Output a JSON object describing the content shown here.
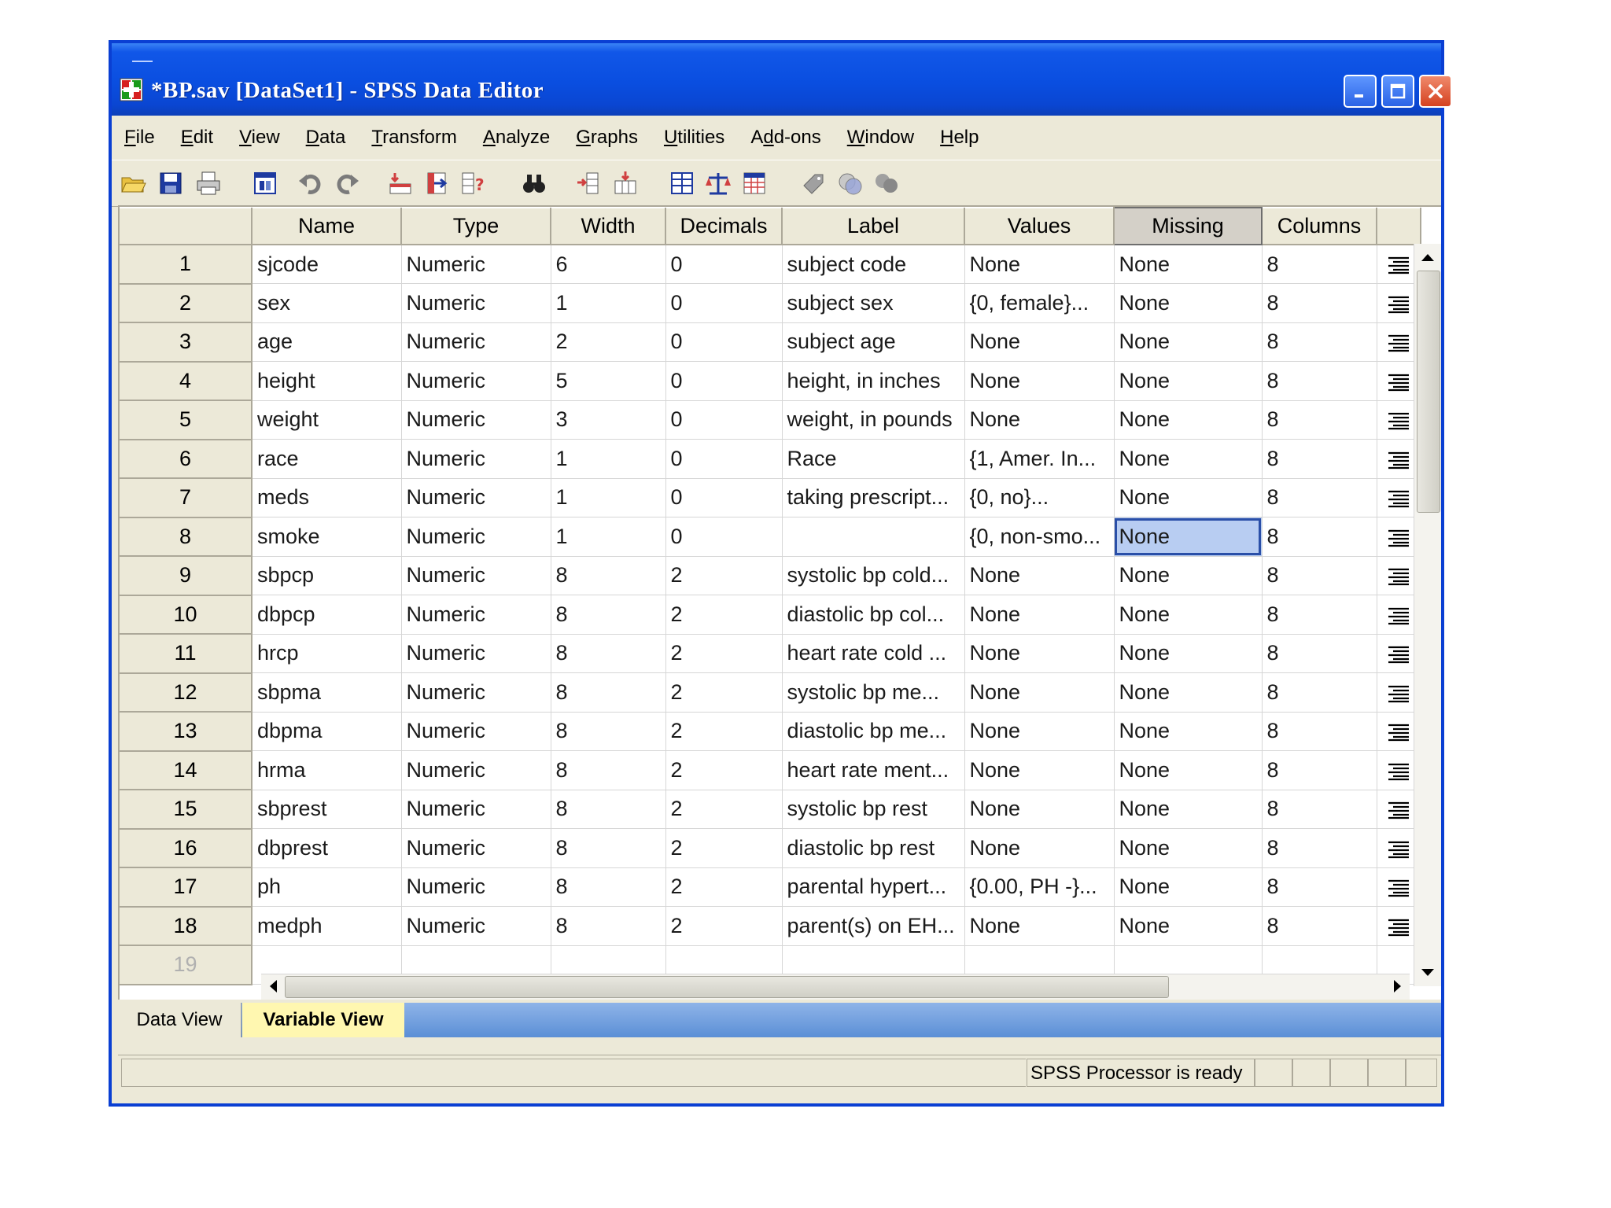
{
  "window": {
    "title": "*BP.sav [DataSet1] - SPSS Data Editor"
  },
  "menu": [
    {
      "pre": "",
      "ul": "F",
      "post": "ile"
    },
    {
      "pre": "",
      "ul": "E",
      "post": "dit"
    },
    {
      "pre": "",
      "ul": "V",
      "post": "iew"
    },
    {
      "pre": "",
      "ul": "D",
      "post": "ata"
    },
    {
      "pre": "",
      "ul": "T",
      "post": "ransform"
    },
    {
      "pre": "",
      "ul": "A",
      "post": "nalyze"
    },
    {
      "pre": "",
      "ul": "G",
      "post": "raphs"
    },
    {
      "pre": "",
      "ul": "U",
      "post": "tilities"
    },
    {
      "pre": "A",
      "ul": "d",
      "post": "d-ons"
    },
    {
      "pre": "",
      "ul": "W",
      "post": "indow"
    },
    {
      "pre": "",
      "ul": "H",
      "post": "elp"
    }
  ],
  "toolbar_icons": [
    "open-folder-icon",
    "save-icon",
    "print-icon",
    "dialog-recall-icon",
    "undo-icon",
    "redo-icon",
    "goto-case-icon",
    "goto-variable-icon",
    "variables-icon",
    "find-icon",
    "insert-cases-icon",
    "insert-variable-icon",
    "split-file-icon",
    "weight-cases-icon",
    "select-cases-icon",
    "value-labels-icon",
    "use-sets-icon",
    "show-all-variables-icon"
  ],
  "grid": {
    "columns": [
      "Name",
      "Type",
      "Width",
      "Decimals",
      "Label",
      "Values",
      "Missing",
      "Columns"
    ],
    "rows": [
      {
        "n": "1",
        "name": "sjcode",
        "type": "Numeric",
        "width": "6",
        "decimals": "0",
        "label": "subject code",
        "values": "None",
        "missing": "None",
        "columns": "8"
      },
      {
        "n": "2",
        "name": "sex",
        "type": "Numeric",
        "width": "1",
        "decimals": "0",
        "label": "subject sex",
        "values": "{0, female}...",
        "missing": "None",
        "columns": "8"
      },
      {
        "n": "3",
        "name": "age",
        "type": "Numeric",
        "width": "2",
        "decimals": "0",
        "label": "subject age",
        "values": "None",
        "missing": "None",
        "columns": "8"
      },
      {
        "n": "4",
        "name": "height",
        "type": "Numeric",
        "width": "5",
        "decimals": "0",
        "label": "height, in inches",
        "values": "None",
        "missing": "None",
        "columns": "8"
      },
      {
        "n": "5",
        "name": "weight",
        "type": "Numeric",
        "width": "3",
        "decimals": "0",
        "label": "weight, in pounds",
        "values": "None",
        "missing": "None",
        "columns": "8"
      },
      {
        "n": "6",
        "name": "race",
        "type": "Numeric",
        "width": "1",
        "decimals": "0",
        "label": "Race",
        "values": "{1, Amer. In...",
        "missing": "None",
        "columns": "8"
      },
      {
        "n": "7",
        "name": "meds",
        "type": "Numeric",
        "width": "1",
        "decimals": "0",
        "label": "taking prescript...",
        "values": "{0, no}...",
        "missing": "None",
        "columns": "8"
      },
      {
        "n": "8",
        "name": "smoke",
        "type": "Numeric",
        "width": "1",
        "decimals": "0",
        "label": "",
        "values": "{0, non-smo...",
        "missing": "None",
        "columns": "8"
      },
      {
        "n": "9",
        "name": "sbpcp",
        "type": "Numeric",
        "width": "8",
        "decimals": "2",
        "label": "systolic bp cold...",
        "values": "None",
        "missing": "None",
        "columns": "8"
      },
      {
        "n": "10",
        "name": "dbpcp",
        "type": "Numeric",
        "width": "8",
        "decimals": "2",
        "label": "diastolic bp col...",
        "values": "None",
        "missing": "None",
        "columns": "8"
      },
      {
        "n": "11",
        "name": "hrcp",
        "type": "Numeric",
        "width": "8",
        "decimals": "2",
        "label": "heart rate cold ...",
        "values": "None",
        "missing": "None",
        "columns": "8"
      },
      {
        "n": "12",
        "name": "sbpma",
        "type": "Numeric",
        "width": "8",
        "decimals": "2",
        "label": "systolic bp me...",
        "values": "None",
        "missing": "None",
        "columns": "8"
      },
      {
        "n": "13",
        "name": "dbpma",
        "type": "Numeric",
        "width": "8",
        "decimals": "2",
        "label": "diastolic bp me...",
        "values": "None",
        "missing": "None",
        "columns": "8"
      },
      {
        "n": "14",
        "name": "hrma",
        "type": "Numeric",
        "width": "8",
        "decimals": "2",
        "label": "heart rate ment...",
        "values": "None",
        "missing": "None",
        "columns": "8"
      },
      {
        "n": "15",
        "name": "sbprest",
        "type": "Numeric",
        "width": "8",
        "decimals": "2",
        "label": "systolic bp rest",
        "values": "None",
        "missing": "None",
        "columns": "8"
      },
      {
        "n": "16",
        "name": "dbprest",
        "type": "Numeric",
        "width": "8",
        "decimals": "2",
        "label": "diastolic bp rest",
        "values": "None",
        "missing": "None",
        "columns": "8"
      },
      {
        "n": "17",
        "name": "ph",
        "type": "Numeric",
        "width": "8",
        "decimals": "2",
        "label": "parental hypert...",
        "values": "{0.00, PH -}...",
        "missing": "None",
        "columns": "8"
      },
      {
        "n": "18",
        "name": "medph",
        "type": "Numeric",
        "width": "8",
        "decimals": "2",
        "label": "parent(s) on EH...",
        "values": "None",
        "missing": "None",
        "columns": "8"
      }
    ],
    "empty_row": "19"
  },
  "tabs": {
    "data_view": "Data View",
    "variable_view": "Variable View"
  },
  "status": {
    "text": "SPSS Processor is ready"
  }
}
